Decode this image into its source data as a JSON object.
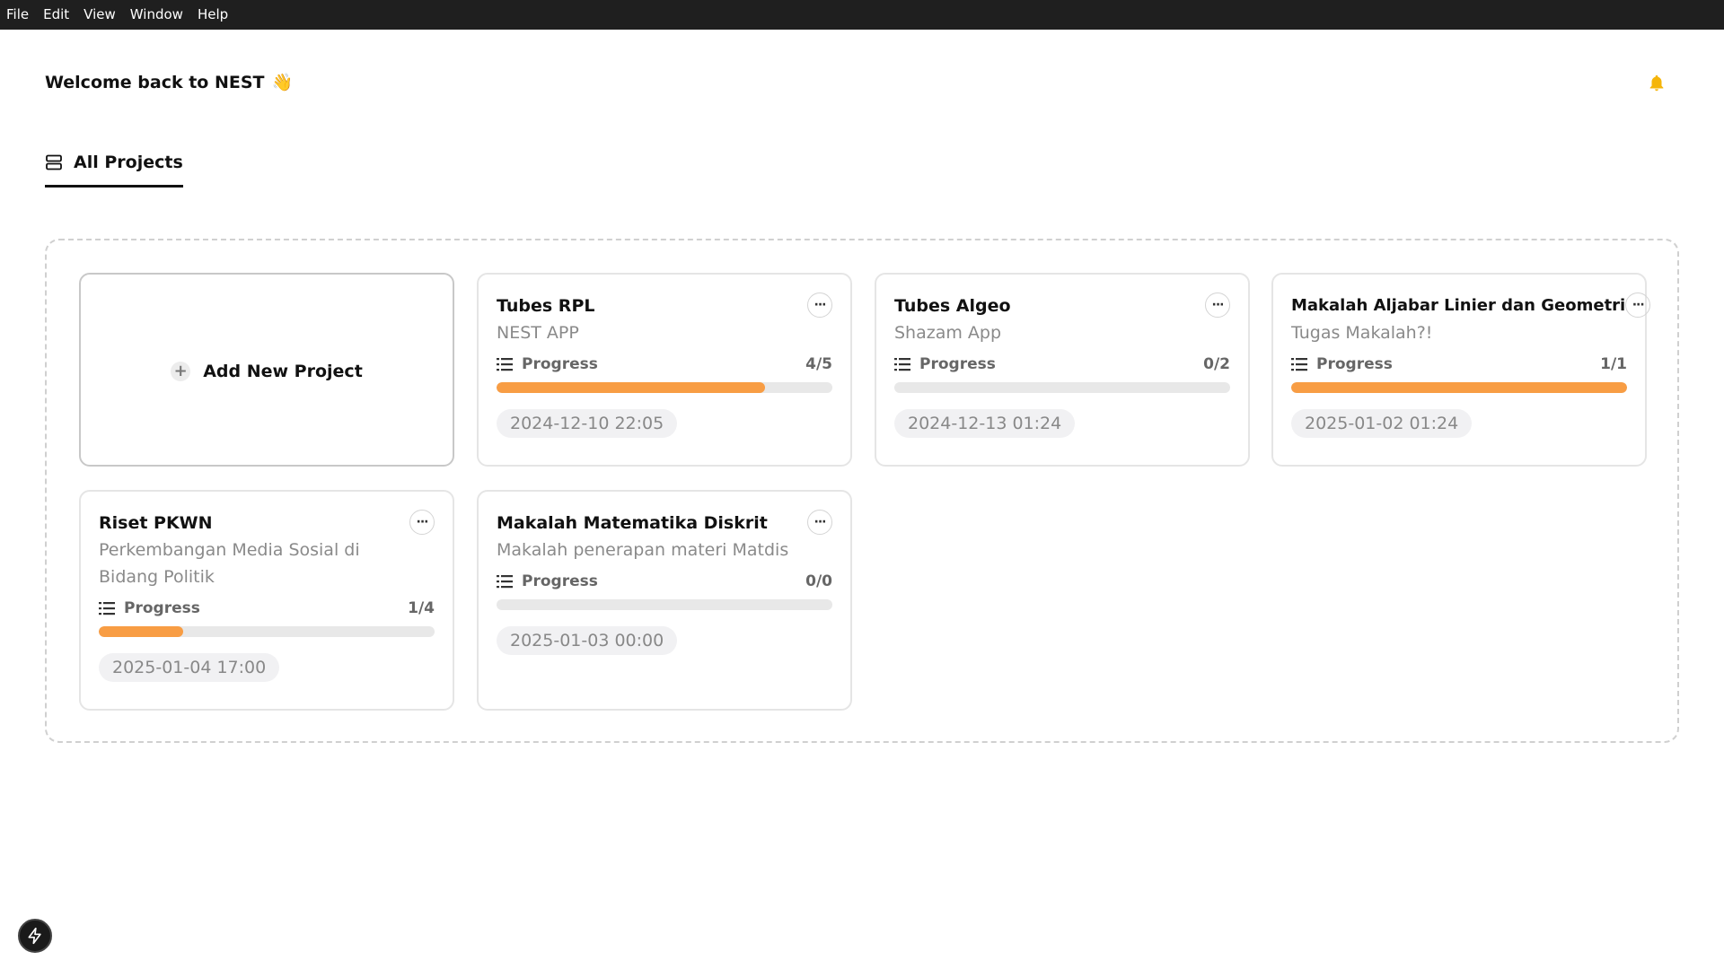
{
  "menu": [
    "File",
    "Edit",
    "View",
    "Window",
    "Help"
  ],
  "header": {
    "welcome": "Welcome back to NEST",
    "wave_emoji": "👋",
    "bell_icon": "bell-icon",
    "bell_color": "#f5b50a"
  },
  "tabs": [
    {
      "label": "All Projects",
      "icon": "stack-icon"
    }
  ],
  "add_project": {
    "label": "Add New Project"
  },
  "accent_color": "#f89d44",
  "projects": [
    {
      "title": "Tubes RPL",
      "subtitle": "NEST APP",
      "progress_label": "Progress",
      "count": "4/5",
      "progress": 0.8,
      "date": "2024-12-10 22:05"
    },
    {
      "title": "Tubes Algeo",
      "subtitle": "Shazam App",
      "progress_label": "Progress",
      "count": "0/2",
      "progress": 0,
      "date": "2024-12-13 01:24"
    },
    {
      "title": "Makalah Aljabar Linier dan Geometri",
      "subtitle": "Tugas Makalah?!",
      "progress_label": "Progress",
      "count": "1/1",
      "progress": 1,
      "date": "2025-01-02 01:24"
    },
    {
      "title": "Riset PKWN",
      "subtitle": "Perkembangan Media Sosial di Bidang Politik",
      "progress_label": "Progress",
      "count": "1/4",
      "progress": 0.25,
      "date": "2025-01-04 17:00"
    },
    {
      "title": "Makalah Matematika Diskrit",
      "subtitle": "Makalah penerapan materi Matdis",
      "progress_label": "Progress",
      "count": "0/0",
      "progress": 0,
      "date": "2025-01-03 00:00"
    }
  ]
}
